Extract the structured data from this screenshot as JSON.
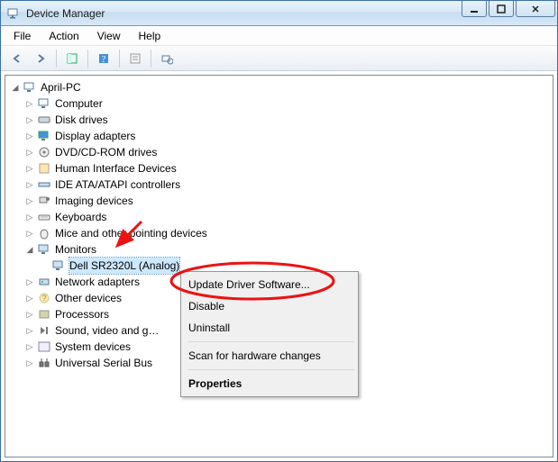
{
  "title": "Device Manager",
  "menubar": [
    "File",
    "Action",
    "View",
    "Help"
  ],
  "tree": {
    "root": "April-PC",
    "categories": [
      {
        "name": "Computer"
      },
      {
        "name": "Disk drives"
      },
      {
        "name": "Display adapters"
      },
      {
        "name": "DVD/CD-ROM drives"
      },
      {
        "name": "Human Interface Devices"
      },
      {
        "name": "IDE ATA/ATAPI controllers"
      },
      {
        "name": "Imaging devices"
      },
      {
        "name": "Keyboards"
      },
      {
        "name": "Mice and other pointing devices"
      },
      {
        "name": "Monitors",
        "expanded": true,
        "children": [
          "Dell SR2320L (Analog)"
        ]
      },
      {
        "name": "Network adapters"
      },
      {
        "name": "Other devices"
      },
      {
        "name": "Processors"
      },
      {
        "name": "Sound, video and game controllers",
        "display": "Sound, video and g…"
      },
      {
        "name": "System devices"
      },
      {
        "name": "Universal Serial Bus controllers",
        "display": "Universal Serial Bus"
      }
    ]
  },
  "context_menu": {
    "items": [
      "Update Driver Software...",
      "Disable",
      "Uninstall",
      "—",
      "Scan for hardware changes",
      "—",
      "Properties"
    ],
    "default_item": "Properties"
  }
}
